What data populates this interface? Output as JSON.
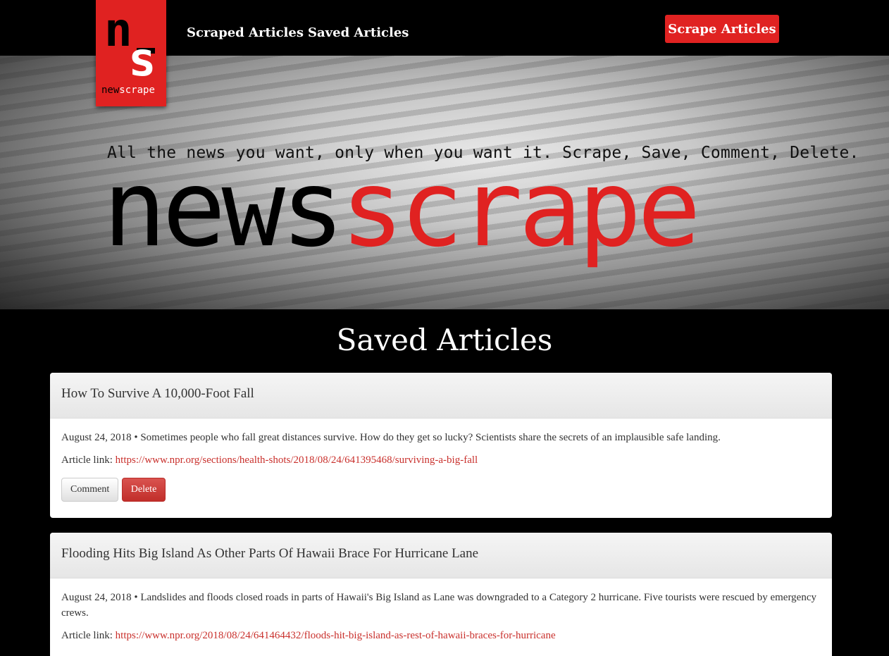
{
  "nav": {
    "logo": {
      "letter_top": "n",
      "letter_bottom": "s",
      "word_part1": "new",
      "word_part2": "scrape"
    },
    "links": [
      "Scraped Articles",
      "Saved Articles"
    ],
    "action_button": "Scrape Articles"
  },
  "hero": {
    "tagline": "All the news you want, only when you want it. Scrape, Save, Comment, Delete.",
    "title_part1": "news",
    "title_part2": "scrape"
  },
  "page_title": "Saved Articles",
  "articles": [
    {
      "title": "How To Survive A 10,000-Foot Fall",
      "summary": "August 24, 2018 • Sometimes people who fall great distances survive. How do they get so lucky? Scientists share the secrets of an implausible safe landing.",
      "link_label": "Article link:",
      "url": "https://www.npr.org/sections/health-shots/2018/08/24/641395468/surviving-a-big-fall",
      "comment_label": "Comment",
      "delete_label": "Delete"
    },
    {
      "title": "Flooding Hits Big Island As Other Parts Of Hawaii Brace For Hurricane Lane",
      "summary": "August 24, 2018 • Landslides and floods closed roads in parts of Hawaii's Big Island as Lane was downgraded to a Category 2 hurricane. Five tourists were rescued by emergency crews.",
      "link_label": "Article link:",
      "url": "https://www.npr.org/2018/08/24/641464432/floods-hit-big-island-as-rest-of-hawaii-braces-for-hurricane"
    }
  ],
  "colors": {
    "brand_red": "#e02221",
    "background": "#000000"
  }
}
